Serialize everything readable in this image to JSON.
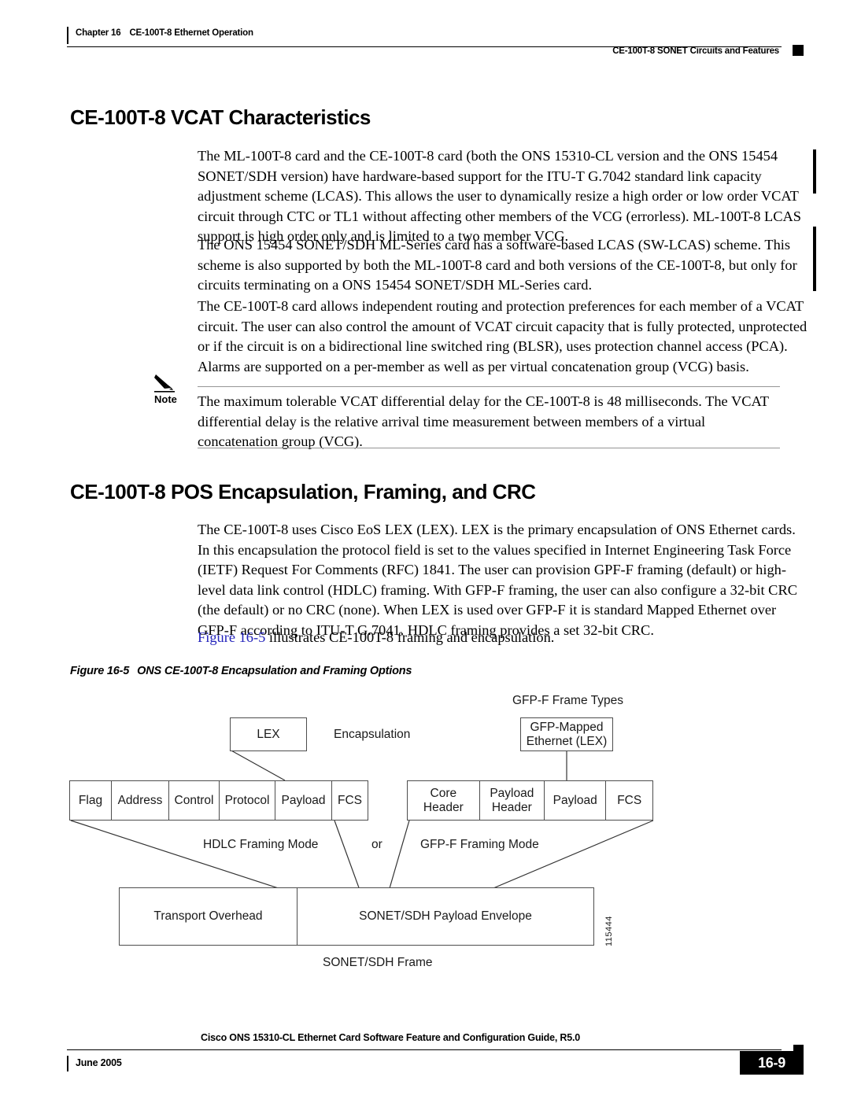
{
  "header": {
    "chapter_number": "Chapter 16",
    "chapter_title": "CE-100T-8 Ethernet Operation",
    "section_title": "CE-100T-8 SONET Circuits and Features"
  },
  "sections": {
    "vcat_heading": "CE-100T-8 VCAT Characteristics",
    "pos_heading": "CE-100T-8 POS Encapsulation, Framing, and CRC"
  },
  "paragraphs": {
    "p1": "The ML-100T-8 card and the CE-100T-8 card (both the ONS 15310-CL version and the ONS 15454 SONET/SDH version) have hardware-based support for the ITU-T G.7042 standard link capacity adjustment scheme (LCAS). This allows the user to dynamically resize a high order or low order VCAT circuit through CTC or TL1 without affecting other members of the VCG (errorless). ML-100T-8 LCAS support is high order only and is limited to a two member VCG.",
    "p2": "The ONS 15454 SONET/SDH ML-Series card has a software-based LCAS (SW-LCAS) scheme. This scheme is also supported by both the ML-100T-8 card and both versions of the CE-100T-8, but only for circuits terminating on a ONS 15454 SONET/SDH ML-Series card.",
    "p3": "The CE-100T-8 card allows independent routing and protection preferences for each member of a VCAT circuit. The user can also control the amount of VCAT circuit capacity that is fully protected, unprotected or if the circuit is on a bidirectional line switched ring (BLSR), uses protection channel access (PCA). Alarms are supported on a per-member as well as per virtual concatenation group (VCG) basis.",
    "p5": "The CE-100T-8 uses Cisco EoS LEX (LEX). LEX is the primary encapsulation of ONS Ethernet cards. In this encapsulation the protocol field is set to the values specified in Internet Engineering Task Force (IETF) Request For Comments (RFC) 1841. The user can provision GPF-F framing (default) or high-level data link control (HDLC) framing. With GFP-F framing, the user can also configure a 32-bit CRC (the default) or no CRC (none). When LEX is used over GFP-F it is standard Mapped Ethernet over GFP-F according to ITU-T G.7041. HDLC framing provides a set 32-bit CRC.",
    "p6_link": "Figure 16-5",
    "p6_rest": " illustrates CE-100T-8 framing and encapsulation."
  },
  "note": {
    "label": "Note",
    "text": "The maximum tolerable VCAT differential delay for the CE-100T-8 is 48 milliseconds. The VCAT differential delay is the relative arrival time measurement between members of a virtual concatenation group (VCG)."
  },
  "figure": {
    "caption_number": "Figure 16-5",
    "caption_title": "ONS CE-100T-8 Encapsulation and Framing Options",
    "figure_id": "115444",
    "labels": {
      "gfp_frame_types": "GFP-F Frame Types",
      "encapsulation": "Encapsulation",
      "hdlc_framing_mode": "HDLC Framing Mode",
      "or": "or",
      "gfpf_framing_mode": "GFP-F Framing Mode",
      "sonet_sdh_frame": "SONET/SDH Frame"
    },
    "lex_box": "LEX",
    "gfp_mapped_box_line1": "GFP-Mapped",
    "gfp_mapped_box_line2": "Ethernet (LEX)",
    "hdlc_fields": [
      "Flag",
      "Address",
      "Control",
      "Protocol",
      "Payload",
      "FCS"
    ],
    "gfp_fields": [
      "Core Header",
      "Payload Header",
      "Payload",
      "FCS"
    ],
    "sonet_fields": [
      "Transport Overhead",
      "SONET/SDH Payload Envelope"
    ]
  },
  "footer": {
    "guide_title": "Cisco ONS 15310-CL Ethernet Card Software Feature and Configuration Guide, R5.0",
    "date": "June 2005",
    "page_number": "16-9"
  }
}
